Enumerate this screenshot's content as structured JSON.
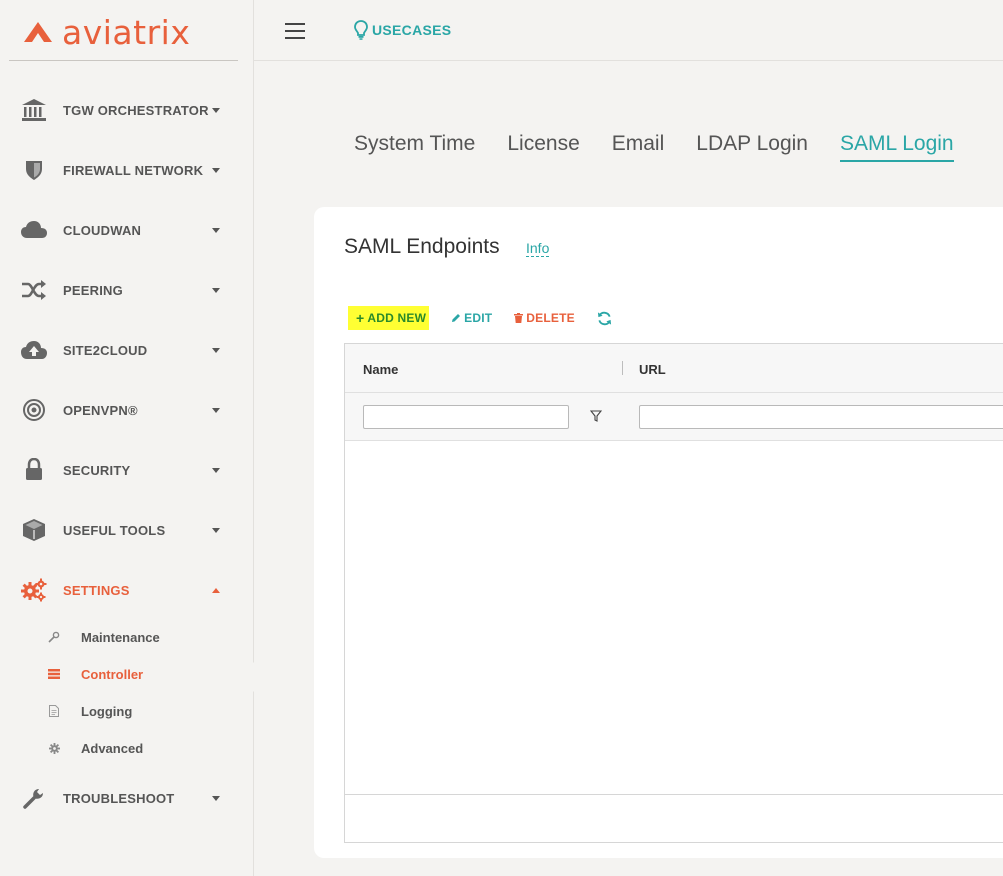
{
  "brand": {
    "name": "aviatrix",
    "color": "#e8603c"
  },
  "topbar": {
    "menu_icon": "hamburger-icon",
    "usecases_label": "USECASES",
    "usecases_icon": "lightbulb-icon"
  },
  "sidebar": {
    "items": [
      {
        "label": "TGW ORCHESTRATOR",
        "icon": "bank-icon"
      },
      {
        "label": "FIREWALL NETWORK",
        "icon": "shield-icon"
      },
      {
        "label": "CLOUDWAN",
        "icon": "cloud-icon"
      },
      {
        "label": "PEERING",
        "icon": "shuffle-icon"
      },
      {
        "label": "SITE2CLOUD",
        "icon": "cloud-upload-icon"
      },
      {
        "label": "OPENVPN®",
        "icon": "target-icon"
      },
      {
        "label": "SECURITY",
        "icon": "lock-icon"
      },
      {
        "label": "USEFUL TOOLS",
        "icon": "cube-icon"
      },
      {
        "label": "SETTINGS",
        "icon": "gears-icon",
        "expanded": true
      },
      {
        "label": "TROUBLESHOOT",
        "icon": "wrench-icon"
      }
    ],
    "settings_sub": [
      {
        "label": "Maintenance",
        "icon": "wrench-small-icon"
      },
      {
        "label": "Controller",
        "icon": "server-icon",
        "active": true
      },
      {
        "label": "Logging",
        "icon": "file-icon"
      },
      {
        "label": "Advanced",
        "icon": "gear-icon"
      }
    ]
  },
  "tabs": [
    "System Time",
    "License",
    "Email",
    "LDAP Login",
    "SAML Login"
  ],
  "active_tab": "SAML Login",
  "card": {
    "title": "SAML Endpoints",
    "info_link": "Info",
    "toolbar": {
      "add": "ADD NEW",
      "edit": "EDIT",
      "delete": "DELETE",
      "refresh_icon": "refresh-icon"
    },
    "grid": {
      "columns": [
        "Name",
        "URL"
      ],
      "rows": []
    }
  },
  "colors": {
    "accent_teal": "#2aa6a6",
    "accent_orange": "#e8603c",
    "add_highlight": "#ffff33",
    "add_text": "#2a8a2a"
  }
}
